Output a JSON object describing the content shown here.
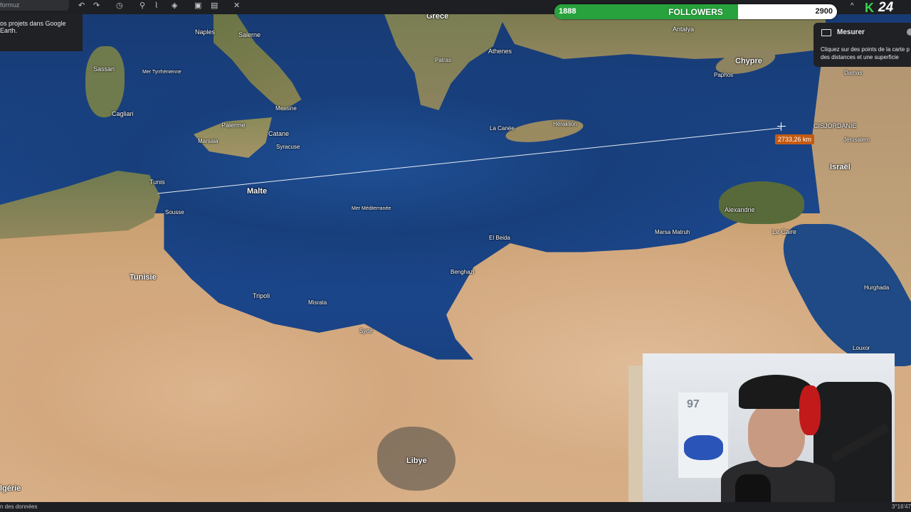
{
  "toolbar": {
    "search_value": "formuz",
    "tip_text": "os projets dans Google Earth."
  },
  "followers": {
    "current": "1888",
    "label": "FOLLOWERS",
    "target": "2900",
    "progress_fraction": 0.651
  },
  "brand": {
    "k": "K",
    "num": "24"
  },
  "measure_panel": {
    "title": "Mesurer",
    "description": "Cliquez sur des points de la carte p des distances et une superficie"
  },
  "map": {
    "distance_label": "2733,26 km",
    "labels": {
      "grece": "Grece",
      "naples": "Naples",
      "salerne": "Salerne",
      "sassari": "Sassari",
      "cagliari": "Cagliari",
      "mer_tyrrhenienne": "Mer Tyrrhénienne",
      "palerme": "Palerme",
      "catane": "Catane",
      "syracuse": "Syracuse",
      "marsala": "Marsala",
      "messine": "Messine",
      "malte": "Malte",
      "tunis": "Tunis",
      "sousse": "Sousse",
      "tunisie": "Tunisie",
      "athenes": "Athenes",
      "patras": "Patras",
      "la_canee": "La Canée",
      "heraklion": "Héraklion",
      "antalya": "Antalya",
      "chypre": "Chypre",
      "paphos": "Paphos",
      "cisjordanie": "CISJORDANIE",
      "israel": "Israël",
      "jerusalem": "Jérusalem",
      "alexandrie": "Alexandrie",
      "le_caire": "Le Caire",
      "mer_mediterranee": "Mer Méditerranée",
      "el_beida": "El Beida",
      "benghazi": "Benghazi",
      "tripoli": "Tripoli",
      "misrata": "Misrata",
      "syrte": "Syrte",
      "marsa_matruh": "Marsa Matruh",
      "libye": "Libye",
      "algerie": "lgérie",
      "hurghada": "Hurghada",
      "louxor": "Louxor",
      "damas": "Damas"
    }
  },
  "bottom": {
    "data_link": "n des données",
    "coords": "3°16'47"
  },
  "colors": {
    "followers_fill": "#27a23c",
    "distance_badge": "#c45a12",
    "k_logo": "#3bd24c"
  }
}
